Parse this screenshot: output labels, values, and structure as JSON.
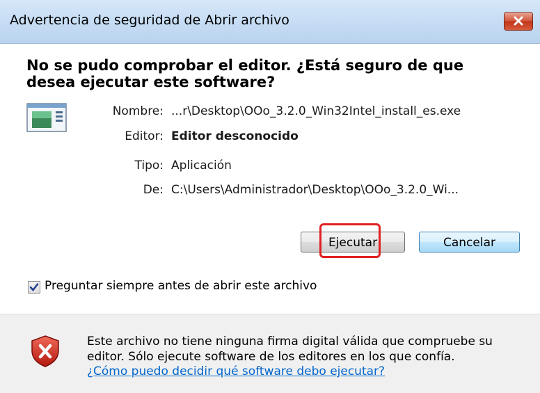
{
  "window": {
    "title": "Advertencia de seguridad de Abrir archivo",
    "close_icon": "close-icon"
  },
  "dialog": {
    "headline": "No se pudo comprobar el editor. ¿Está seguro de que desea ejecutar este software?",
    "app_icon": "application-icon",
    "fields": {
      "name_label": "Nombre:",
      "name_value": "...r\\Desktop\\OOo_3.2.0_Win32Intel_install_es.exe",
      "publisher_label": "Editor:",
      "publisher_value": "Editor desconocido",
      "type_label": "Tipo:",
      "type_value": "Aplicación",
      "from_label": "De:",
      "from_value": "C:\\Users\\Administrador\\Desktop\\OOo_3.2.0_Wi..."
    },
    "buttons": {
      "run_label": "Ejecutar",
      "cancel_label": "Cancelar"
    },
    "checkbox": {
      "label": "Preguntar siempre antes de abrir este archivo",
      "checked": true
    },
    "highlight_color": "#e02020"
  },
  "footer": {
    "icon": "shield-error-icon",
    "warning": "Este archivo no tiene ninguna firma digital válida que compruebe su editor. Sólo ejecute software de los editores en los que confía.",
    "help_link": "¿Cómo puedo decidir qué software debo ejecutar?"
  }
}
